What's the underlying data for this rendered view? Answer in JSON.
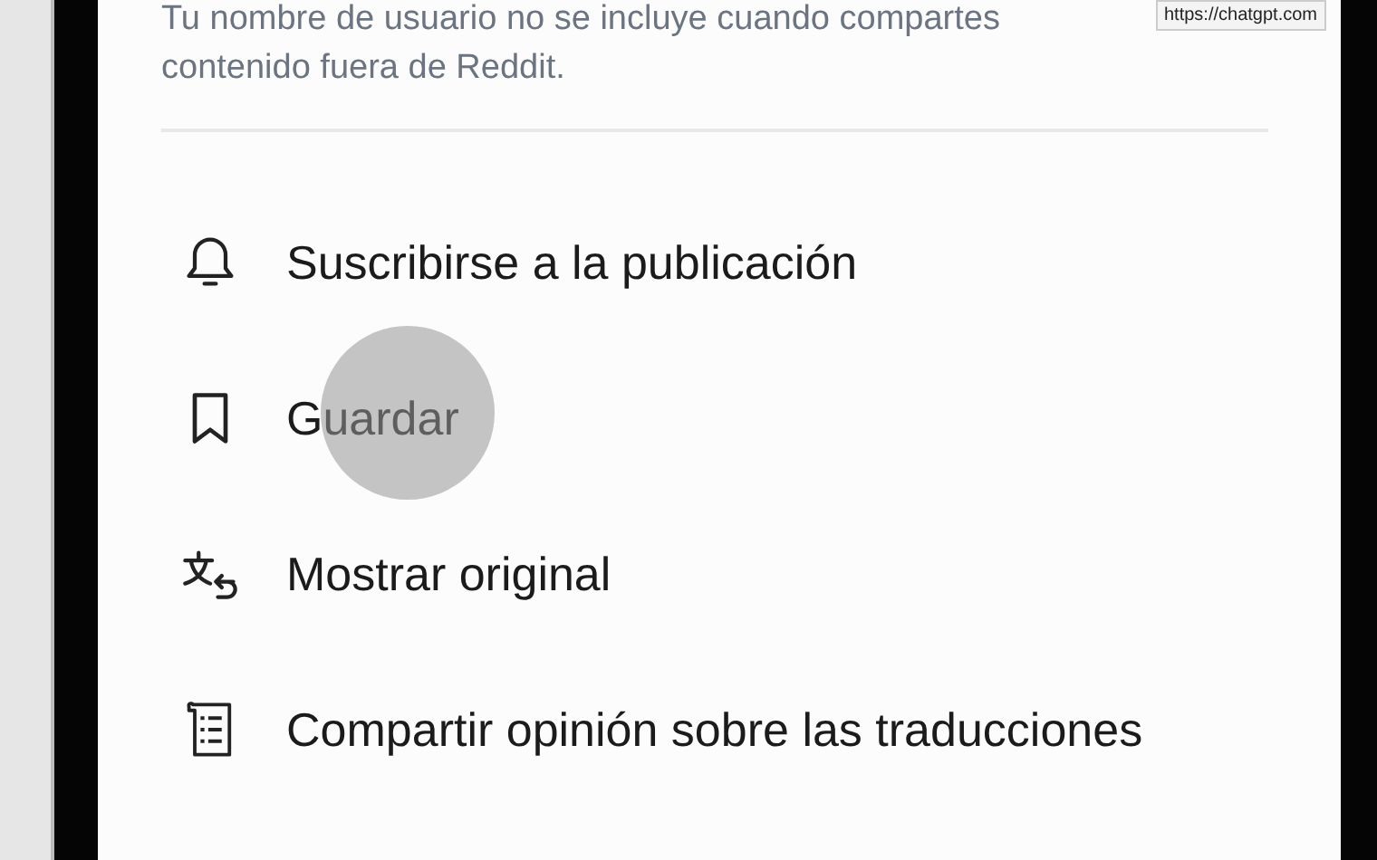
{
  "notice": {
    "text": "Tu nombre de usuario no se incluye cuando compartes",
    "text_2": "contenido fuera de Reddit."
  },
  "tooltip": {
    "text": "https://chatgpt.com"
  },
  "menu": [
    {
      "kind": "bell",
      "label": "Suscribirse a la publicación"
    },
    {
      "kind": "bookmark",
      "label": "Guardar",
      "touched": true
    },
    {
      "kind": "translate",
      "label": "Mostrar original"
    },
    {
      "kind": "feedback",
      "label": "Compartir opinión sobre las traducciones"
    }
  ]
}
